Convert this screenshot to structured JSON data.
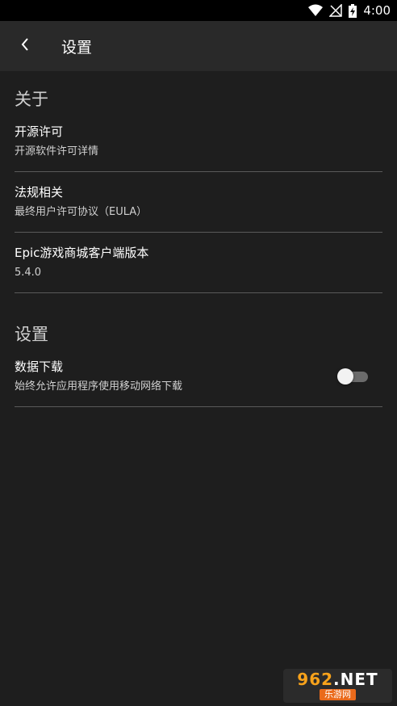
{
  "status_bar": {
    "time": "4:00",
    "icons": [
      "wifi-icon",
      "no-signal-icon",
      "battery-charging-icon"
    ]
  },
  "app_bar": {
    "back_icon": "chevron-left-icon",
    "title": "设置"
  },
  "sections": [
    {
      "header": "关于",
      "items": [
        {
          "title": "开源许可",
          "subtitle": "开源软件许可详情"
        },
        {
          "title": "法规相关",
          "subtitle": "最终用户许可协议（EULA）"
        },
        {
          "title": "Epic游戏商城客户端版本",
          "subtitle": "5.4.0"
        }
      ]
    },
    {
      "header": "设置",
      "items": [
        {
          "title": "数据下载",
          "subtitle": "始终允许应用程序使用移动网络下载",
          "toggle": false
        }
      ]
    }
  ],
  "watermark": {
    "top_number": "962",
    "top_suffix": ".NET",
    "bottom": "乐游网"
  },
  "colors": {
    "background": "#1e1e1e",
    "app_bar": "#292929",
    "divider": "#5a5a5a",
    "watermark_orange": "#f7a21b"
  }
}
